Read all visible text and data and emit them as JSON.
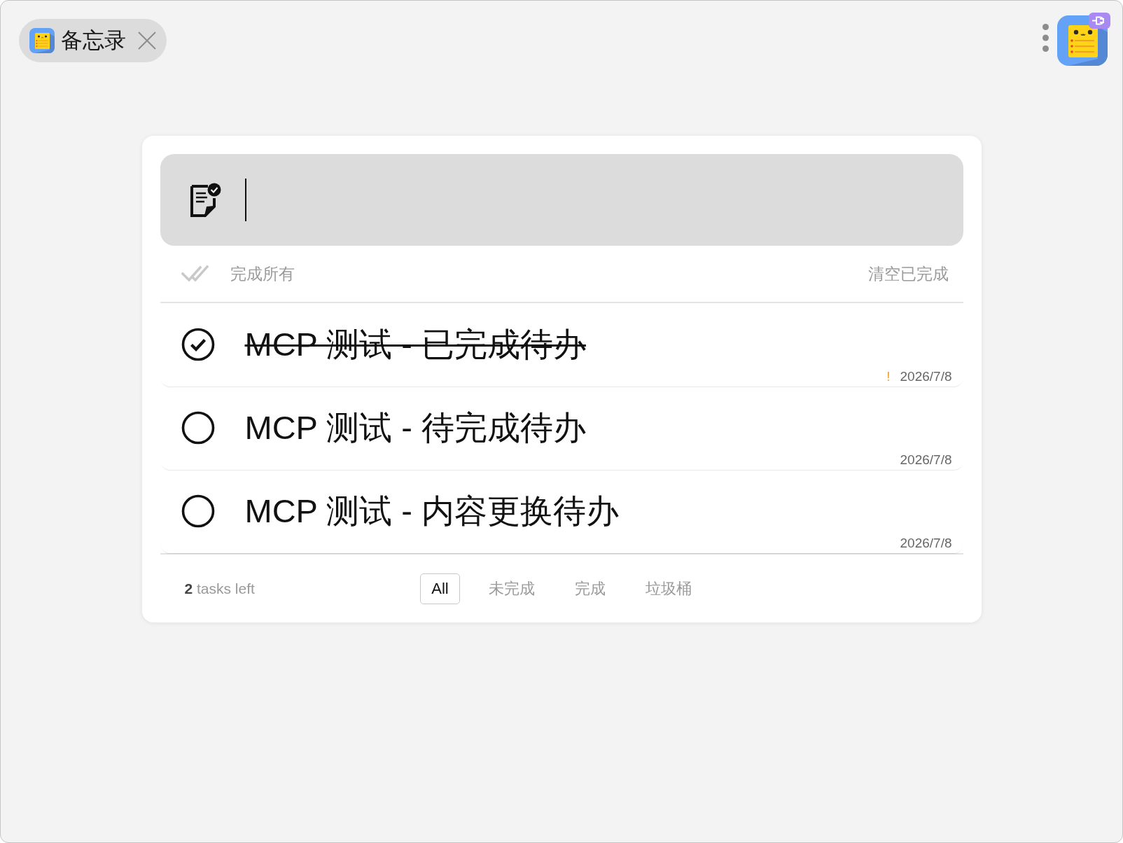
{
  "tab": {
    "title": "备忘录"
  },
  "new_todo": {
    "focused": true
  },
  "toolbar": {
    "complete_all": "完成所有",
    "clear_completed": "清空已完成"
  },
  "todos": [
    {
      "title": "MCP 测试 - 已完成待办",
      "completed": true,
      "flag": "!",
      "date": "2026/7/8"
    },
    {
      "title": "MCP 测试 - 待完成待办",
      "completed": false,
      "date": "2026/7/8"
    },
    {
      "title": "MCP 测试 - 内容更换待办",
      "completed": false,
      "date": "2026/7/8"
    }
  ],
  "footer": {
    "tasks_left": "**2** tasks left",
    "filters": [
      {
        "label": "All",
        "selected": true
      },
      {
        "label": "未完成",
        "selected": false
      },
      {
        "label": "完成",
        "selected": false
      },
      {
        "label": "垃圾桶",
        "selected": false
      }
    ]
  }
}
